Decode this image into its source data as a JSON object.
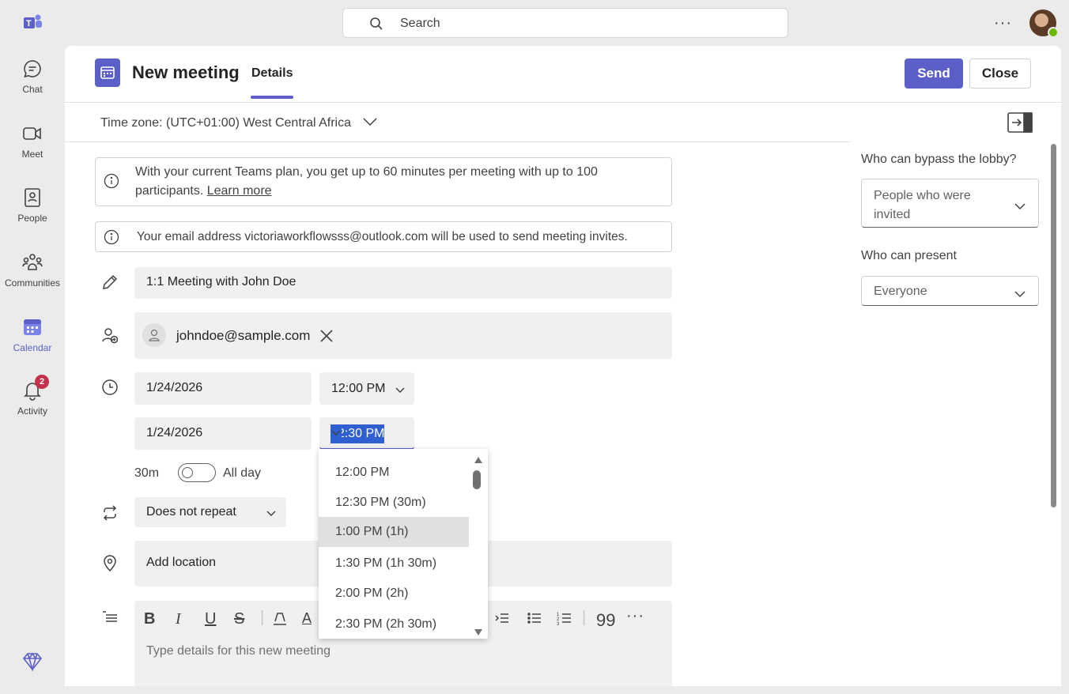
{
  "rail": {
    "items": [
      {
        "label": "Chat",
        "icon": "chat-icon"
      },
      {
        "label": "Meet",
        "icon": "video-icon"
      },
      {
        "label": "People",
        "icon": "people-icon"
      },
      {
        "label": "Communities",
        "icon": "communities-icon"
      },
      {
        "label": "Calendar",
        "icon": "calendar-icon",
        "active": true
      },
      {
        "label": "Activity",
        "icon": "bell-icon",
        "badge": "2"
      }
    ]
  },
  "search": {
    "placeholder": "Search"
  },
  "meeting": {
    "title": "New meeting",
    "tab": "Details",
    "send_label": "Send",
    "close_label": "Close",
    "timezone": "Time zone: (UTC+01:00) West Central Africa",
    "plan_notice": "With your current Teams plan, you get up to 60 minutes per meeting with up to 100 participants.",
    "learn_more": "Learn more",
    "email_notice": "Your email address victoriaworkflowsss@outlook.com will be used to send meeting invites.",
    "subject": "1:1 Meeting with John Doe",
    "attendee": "johndoe@sample.com",
    "start_date": "1/24/2026",
    "start_time": "12:00 PM",
    "end_date": "1/24/2026",
    "end_time": "12:30 PM",
    "duration": "30m",
    "all_day": "All day",
    "repeat": "Does not repeat",
    "location_placeholder": "Add location",
    "details_placeholder": "Type details for this new meeting"
  },
  "time_dropdown": {
    "options": [
      "12:00 PM",
      "12:30 PM (30m)",
      "1:00 PM (1h)",
      "1:30 PM (1h 30m)",
      "2:00 PM (2h)",
      "2:30 PM (2h 30m)"
    ],
    "highlighted": "1:00 PM (1h)"
  },
  "options_pane": {
    "lobby_label": "Who can bypass the lobby?",
    "lobby_value": "People who were invited",
    "present_label": "Who can present",
    "present_value": "Everyone"
  },
  "colors": {
    "accent": "#5b5fc7",
    "badge": "#c4314b"
  }
}
